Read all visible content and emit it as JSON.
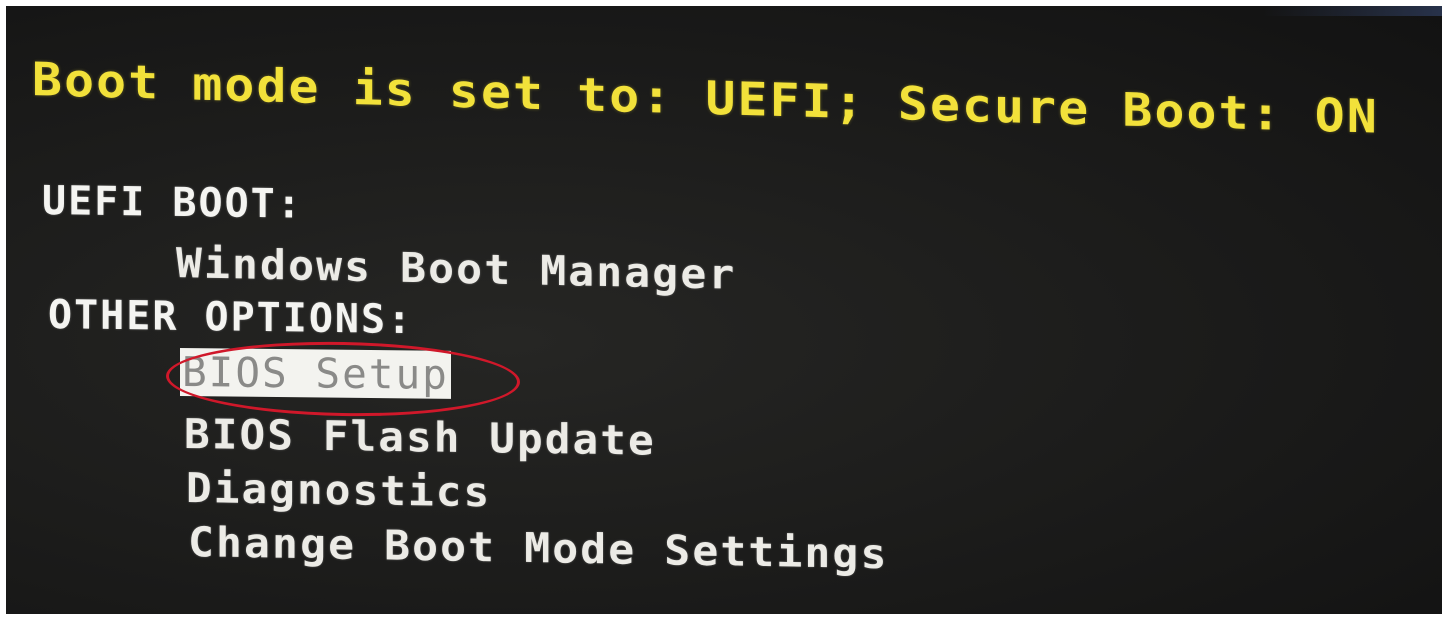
{
  "screen": {
    "boot_mode_line": "Boot mode is set to: UEFI; Secure Boot: ON",
    "uefi_section": {
      "header": "UEFI BOOT:",
      "items": [
        "Windows Boot Manager"
      ]
    },
    "other_section": {
      "header": "OTHER OPTIONS:",
      "items": [
        "BIOS Setup",
        "BIOS Flash Update",
        "Diagnostics",
        "Change Boot Mode Settings"
      ]
    },
    "selected_item": "BIOS Setup"
  },
  "colors": {
    "background": "#1b1b1a",
    "status_text": "#f2e13a",
    "menu_text": "#ecebe6",
    "selection_background": "#f3f3ef",
    "selection_text": "#8a8a88",
    "annotation_ring": "#d0182a"
  }
}
